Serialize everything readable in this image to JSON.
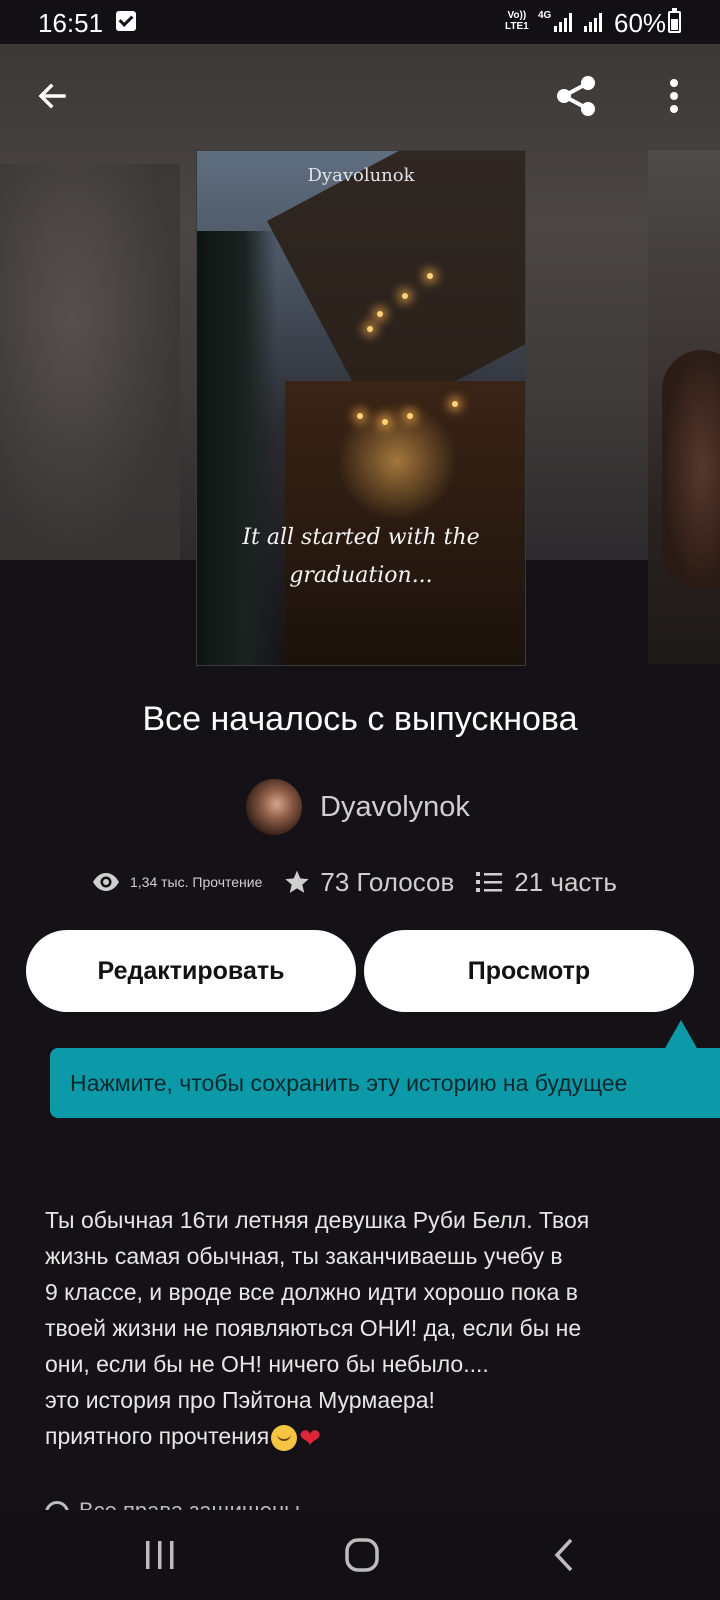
{
  "status_bar": {
    "time": "16:51",
    "network_volte": "Vo)) LTE1",
    "network_type": "4G",
    "battery_percent": "60%",
    "battery_level": 0.6
  },
  "toolbar": {
    "back_icon": "arrow-left-icon",
    "share_icon": "share-icon",
    "more_icon": "more-vertical-icon"
  },
  "cover": {
    "author_text": "Dyavolunok",
    "tagline_line1": "It all started with the",
    "tagline_line2": "graduation..."
  },
  "story": {
    "title": "Все началось с выпускнова",
    "author": "Dyavolynok"
  },
  "stats": {
    "reads": "1,34 тыс. Прочтение",
    "votes": "73 Голосов",
    "parts": "21 часть"
  },
  "buttons": {
    "edit": "Редактировать",
    "view": "Просмотр"
  },
  "tooltip": {
    "text": "Нажмите, чтобы сохранить эту историю на будущее"
  },
  "description": {
    "line1": "Ты обычная 16ти летняя девушка Руби Белл. Твоя",
    "line2": "жизнь самая обычная, ты заканчиваешь учебу в",
    "line3": "9 классе, и вроде все должно идти хорошо пока в",
    "line4": "твоей жизни не появляються ОНИ! да, если бы не",
    "line5": "они, если бы не ОН! ничего бы небыло....",
    "line6": "это история про Пэйтона Мурмаера!",
    "line7": "приятного прочтения"
  },
  "rights": {
    "text": "Все права защищены"
  },
  "colors": {
    "background": "#141216",
    "tooltip": "#0d9aa8",
    "button": "#ffffff"
  }
}
